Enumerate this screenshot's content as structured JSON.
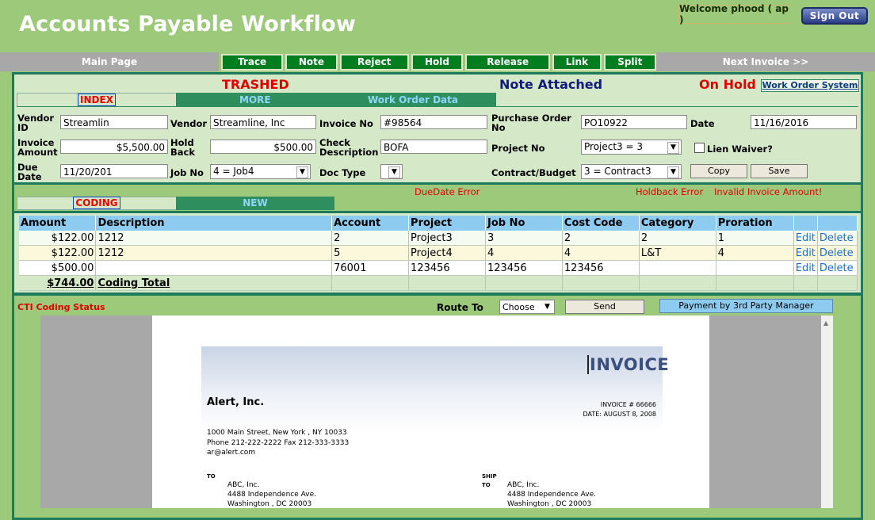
{
  "app": {
    "title": "Accounts Payable Workflow",
    "welcome": "Welcome phood ( ap )",
    "sign_out": "Sign Out"
  },
  "nav": {
    "main_page": "Main Page",
    "next_invoice": "Next Invoice >>",
    "actions": [
      "Trace",
      "Note",
      "Reject",
      "Hold",
      "Release",
      "Link",
      "Split"
    ]
  },
  "status": {
    "trashed": "TRASHED",
    "note_attached": "Note Attached",
    "on_hold": "On Hold",
    "work_order_system": "Work Order System"
  },
  "header_tabs": {
    "index": "INDEX",
    "more": "MORE",
    "work_order_data": "Work Order Data"
  },
  "form": {
    "vendor_id_label": "Vendor ID",
    "vendor_id": "Streamlin",
    "vendor_label": "Vendor",
    "vendor": "Streamline, Inc",
    "invoice_no_label": "Invoice No",
    "invoice_no": "#98564",
    "po_label": "Purchase Order No",
    "po": "PO10922",
    "date_label": "Date",
    "date": "11/16/2016",
    "invoice_amount_label": "Invoice Amount",
    "invoice_amount": "$5,500.00",
    "hold_back_label": "Hold Back",
    "hold_back": "$500.00",
    "check_desc_label": "Check Description",
    "check_desc": "BOFA",
    "project_no_label": "Project No",
    "project_no": "Project3 = 3",
    "lien_waiver_label": "Lien Waiver?",
    "due_date_label": "Due Date",
    "due_date": "11/20/201",
    "job_no_label": "Job No",
    "job_no": "4 = Job4",
    "doc_type_label": "Doc Type",
    "doc_type": "",
    "contract_label": "Contract/Budget",
    "contract": "3 =  Contract3",
    "copy": "Copy",
    "save": "Save"
  },
  "coding_tabs": {
    "coding": "CODING",
    "new": "NEW"
  },
  "errors": {
    "due_date": "DueDate Error",
    "holdback": "Holdback Error",
    "invalid_amount": "Invalid Invoice Amount!"
  },
  "table": {
    "headers": [
      "Amount",
      "Description",
      "Account",
      "Project",
      "Job No",
      "Cost Code",
      "Category",
      "Proration",
      "",
      ""
    ],
    "rows": [
      [
        "$122.00",
        "1212",
        "2",
        "Project3",
        "3",
        "2",
        "2",
        "1",
        "Edit",
        "Delete"
      ],
      [
        "$122.00",
        "1212",
        "5",
        "Project4",
        "4",
        "4",
        "L&T",
        "4",
        "Edit",
        "Delete"
      ],
      [
        "$500.00",
        "",
        "76001",
        "123456",
        "123456",
        "123456",
        "",
        "",
        "Edit",
        "Delete"
      ]
    ],
    "total_amount": "$744.00",
    "total_label": "Coding Total"
  },
  "route": {
    "cti_status": "CTI Coding Status",
    "route_to_label": "Route To",
    "route_to": "Choose",
    "send": "Send",
    "third_party": "Payment by 3rd Party Manager"
  },
  "invoice_doc": {
    "title": "INVOICE",
    "company": "Alert, Inc.",
    "invoice_no": "INVOICE # 66666",
    "date": "DATE: AUGUST 8, 2008",
    "address1": "1000 Main Street, New York , NY 10033",
    "phone": "Phone 212-222-2222  Fax 212-333-3333",
    "email": "ar@alert.com",
    "to_label": "TO",
    "ship_label": "SHIP",
    "ship_label2": "TO",
    "to_name": "ABC, Inc.",
    "to_street": "4488 Independence Ave.",
    "to_city": "Washington , DC 20003",
    "ship_name": "ABC, Inc.",
    "ship_street": "4488 Independence Ave.",
    "ship_city": "Washington , DC 20003"
  },
  "colors": {
    "background": "#9cc97a",
    "panel": "#d5e8c7",
    "border": "#1e7a5d",
    "action_button": "#007d1f",
    "table_header": "#8ecbf0",
    "error": "#e00000"
  }
}
